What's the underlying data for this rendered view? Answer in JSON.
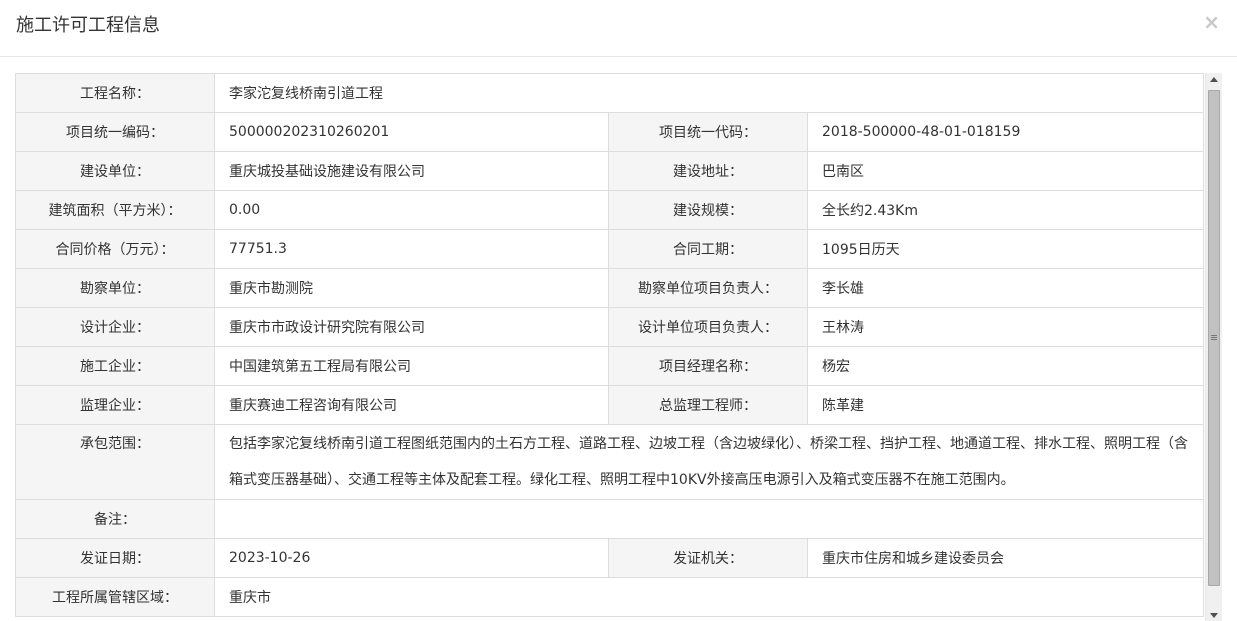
{
  "modal": {
    "title": "施工许可工程信息",
    "close_label": "×"
  },
  "rows": {
    "project_name": {
      "label": "工程名称：",
      "value": "李家沱复线桥南引道工程"
    },
    "project_code": {
      "label": "项目统一编码：",
      "value": "500000202310260201"
    },
    "project_unified_code": {
      "label": "项目统一代码：",
      "value": "2018-500000-48-01-018159"
    },
    "builder": {
      "label": "建设单位：",
      "value": "重庆城投基础设施建设有限公司"
    },
    "build_address": {
      "label": "建设地址：",
      "value": "巴南区"
    },
    "floor_area": {
      "label": "建筑面积（平方米）：",
      "value": "0.00"
    },
    "build_scale": {
      "label": "建设规模：",
      "value": "全长约2.43Km"
    },
    "contract_price": {
      "label": "合同价格（万元）：",
      "value": "77751.3"
    },
    "contract_period": {
      "label": "合同工期：",
      "value": "1095日历天"
    },
    "survey_unit": {
      "label": "勘察单位：",
      "value": "重庆市勘测院"
    },
    "survey_lead": {
      "label": "勘察单位项目负责人：",
      "value": "李长雄"
    },
    "design_company": {
      "label": "设计企业：",
      "value": "重庆市市政设计研究院有限公司"
    },
    "design_lead": {
      "label": "设计单位项目负责人：",
      "value": "王林涛"
    },
    "construction_company": {
      "label": "施工企业：",
      "value": "中国建筑第五工程局有限公司"
    },
    "project_manager": {
      "label": "项目经理名称：",
      "value": "杨宏"
    },
    "supervision_company": {
      "label": "监理企业：",
      "value": "重庆赛迪工程咨询有限公司"
    },
    "chief_supervisor": {
      "label": "总监理工程师：",
      "value": "陈革建"
    },
    "contract_scope": {
      "label": "承包范围：",
      "value": "包括李家沱复线桥南引道工程图纸范围内的土石方工程、道路工程、边坡工程（含边坡绿化）、桥梁工程、挡护工程、地通道工程、排水工程、照明工程（含箱式变压器基础）、交通工程等主体及配套工程。绿化工程、照明工程中10KV外接高压电源引入及箱式变压器不在施工范围内。"
    },
    "remarks": {
      "label": "备注：",
      "value": ""
    },
    "issue_date": {
      "label": "发证日期：",
      "value": "2023-10-26"
    },
    "issuing_authority": {
      "label": "发证机关：",
      "value": "重庆市住房和城乡建设委员会"
    },
    "jurisdiction": {
      "label": "工程所属管辖区域：",
      "value": "重庆市"
    }
  }
}
